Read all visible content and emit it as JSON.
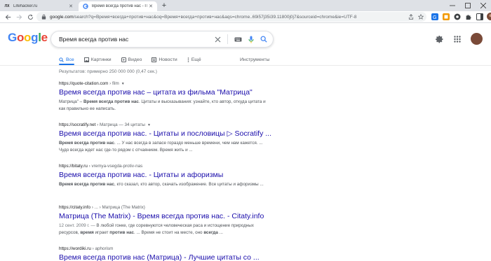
{
  "browser": {
    "tabs": [
      {
        "favicon": "ЛХ",
        "title": "Lifehacker.ru"
      },
      {
        "favicon": "G",
        "title": "Время всегда против нас - Пои"
      }
    ],
    "url_host": "google.com",
    "url_rest": "/search?q=Время+всегда+против+нас&oq=Время+всегда+против+нас&aqs=chrome..69i57j35i39.11800j0j7&sourceid=chrome&ie=UTF-8"
  },
  "google": {
    "logo_letters": [
      {
        "char": "G",
        "color": "#4285f4"
      },
      {
        "char": "o",
        "color": "#ea4335"
      },
      {
        "char": "o",
        "color": "#fbbc05"
      },
      {
        "char": "g",
        "color": "#4285f4"
      },
      {
        "char": "l",
        "color": "#34a853"
      },
      {
        "char": "e",
        "color": "#ea4335"
      }
    ],
    "query": "Время всегда против нас",
    "tabs": [
      {
        "icon": "search-icon",
        "label": "Все"
      },
      {
        "icon": "image-icon",
        "label": "Картинки"
      },
      {
        "icon": "video-icon",
        "label": "Видео"
      },
      {
        "icon": "news-icon",
        "label": "Новости"
      },
      {
        "icon": "more-icon",
        "label": "Ещё"
      }
    ],
    "tools": "Инструменты",
    "stats": "Результатов: примерно 250 000 000 (0,47 сек.)"
  },
  "results": [
    {
      "site": "https://quote-citation.com",
      "path": "› film",
      "title": "Время всегда против нас – цитата из фильма \"Матрица\"",
      "snippet": [
        {
          "t": "Матрица\" – ",
          "b": false
        },
        {
          "t": "Время всегда против нас",
          "b": true
        },
        {
          "t": ". Цитаты и высказывания: узнайте, кто автор, откуда цитата и как правильно ее написать.",
          "b": false
        }
      ]
    },
    {
      "site": "https://socratify.net",
      "path": "› Матрица — 34 цитаты",
      "title": "Время всегда против нас. - Цитаты и пословицы ▷ Socratify ...",
      "snippet": [
        {
          "t": "Время всегда против нас",
          "b": true
        },
        {
          "t": ". ... У нас всегда в запасе гораздо меньше времени, чем нам кажется. ... Чудо всегда ждет нас где-то рядом с отчаянием. Время жить и ...",
          "b": false
        }
      ]
    },
    {
      "site": "https://bitaty.ru",
      "path": "› vremya-vsegda-protiv-nas",
      "title": "Время всегда против нас. - Цитаты и афоризмы",
      "snippet": [
        {
          "t": "Время всегда против нас",
          "b": true
        },
        {
          "t": ", кто сказал, кто автор, скачать изображение. Все цитаты и афоризмы ...",
          "b": false
        }
      ]
    },
    {
      "site": "https://citaty.info",
      "path": "› ... › Матрица (The Matrix)",
      "title": "Матрица (The Matrix) - Время всегда против нас. - Citaty.info",
      "date": "12 сент. 2009 г. — ",
      "snippet": [
        {
          "t": "В любой гонке, где соревнуются человеческая раса и истощение природных ресурсов, ",
          "b": false
        },
        {
          "t": "время",
          "b": true
        },
        {
          "t": " играет ",
          "b": false
        },
        {
          "t": "против нас",
          "b": true
        },
        {
          "t": ". ... Время не стоит на месте, оно ",
          "b": false
        },
        {
          "t": "всегда",
          "b": true
        },
        {
          "t": " ...",
          "b": false
        }
      ]
    },
    {
      "site": "https://wordiki.ru",
      "path": "› aphorism",
      "title": "Время всегда против нас (Матрица) - Лучшие цитаты со ...",
      "snippet": []
    }
  ]
}
